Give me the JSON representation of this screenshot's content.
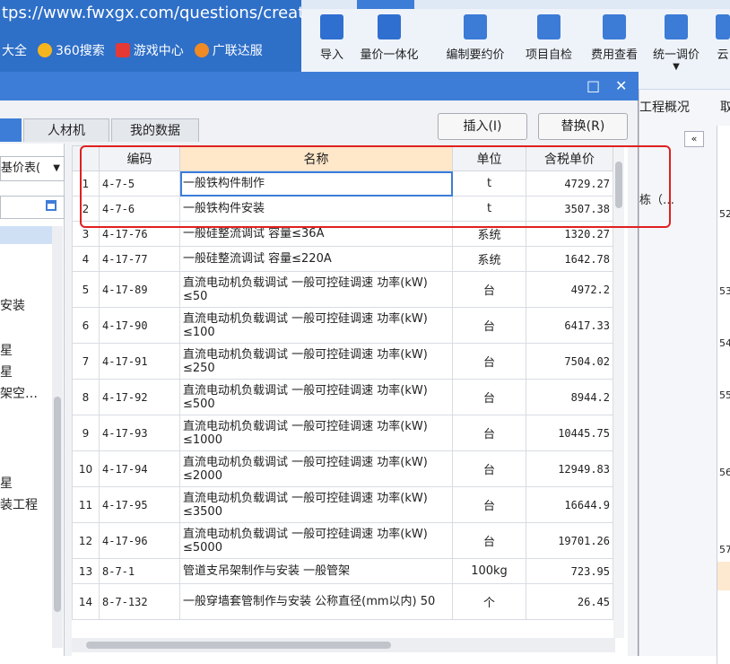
{
  "browser": {
    "url": "tps://www.fwxgx.com/questions/create",
    "bookmarks": [
      {
        "label": "大全",
        "icon": ""
      },
      {
        "label": "360搜索",
        "icon": "360-icon"
      },
      {
        "label": "游戏中心",
        "icon": "game-center-icon"
      },
      {
        "label": "广联达服",
        "icon": "location-icon"
      }
    ]
  },
  "ribbon": {
    "buttons": [
      {
        "label": "导入",
        "icon": "import-icon"
      },
      {
        "label": "量价一体化",
        "icon": "quantity-price-icon"
      },
      {
        "label": "编制要约价",
        "icon": "edit-price-icon"
      },
      {
        "label": "项目自检",
        "icon": "self-check-icon"
      },
      {
        "label": "费用查看",
        "icon": "fee-view-icon"
      },
      {
        "label": "统一调价",
        "icon": "adjust-price-icon"
      },
      {
        "label": "云",
        "icon": "cloud-icon"
      }
    ]
  },
  "right_panel": {
    "tab1": "工程概况",
    "tab2": "取",
    "item": "栋（…",
    "row_labels": [
      "52",
      "53",
      "54",
      "55",
      "56",
      "57"
    ]
  },
  "dialog": {
    "tabs": [
      "人材机",
      "我的数据"
    ],
    "insert_button": "插入(I)",
    "replace_button": "替换(R)",
    "tree_select": "基价表(",
    "tree_items": [
      "安装",
      "星",
      "星",
      "架空…",
      "星",
      "装工程"
    ]
  },
  "grid": {
    "headers": {
      "code": "编码",
      "name": "名称",
      "unit": "单位",
      "price": "含税单价"
    },
    "rows": [
      {
        "num": "1",
        "code": "4-7-5",
        "name": "一般铁构件制作",
        "unit": "t",
        "price": "4729.27"
      },
      {
        "num": "2",
        "code": "4-7-6",
        "name": "一般铁构件安装",
        "unit": "t",
        "price": "3507.38"
      },
      {
        "num": "3",
        "code": "4-17-76",
        "name": "一般硅整流调试 容量≤36A",
        "unit": "系统",
        "price": "1320.27"
      },
      {
        "num": "4",
        "code": "4-17-77",
        "name": "一般硅整流调试 容量≤220A",
        "unit": "系统",
        "price": "1642.78"
      },
      {
        "num": "5",
        "code": "4-17-89",
        "name": "直流电动机负载调试 一般可控硅调速 功率(kW) ≤50",
        "unit": "台",
        "price": "4972.2"
      },
      {
        "num": "6",
        "code": "4-17-90",
        "name": "直流电动机负载调试 一般可控硅调速 功率(kW) ≤100",
        "unit": "台",
        "price": "6417.33"
      },
      {
        "num": "7",
        "code": "4-17-91",
        "name": "直流电动机负载调试 一般可控硅调速 功率(kW) ≤250",
        "unit": "台",
        "price": "7504.02"
      },
      {
        "num": "8",
        "code": "4-17-92",
        "name": "直流电动机负载调试 一般可控硅调速 功率(kW) ≤500",
        "unit": "台",
        "price": "8944.2"
      },
      {
        "num": "9",
        "code": "4-17-93",
        "name": "直流电动机负载调试 一般可控硅调速 功率(kW) ≤1000",
        "unit": "台",
        "price": "10445.75"
      },
      {
        "num": "10",
        "code": "4-17-94",
        "name": "直流电动机负载调试 一般可控硅调速 功率(kW) ≤2000",
        "unit": "台",
        "price": "12949.83"
      },
      {
        "num": "11",
        "code": "4-17-95",
        "name": "直流电动机负载调试 一般可控硅调速 功率(kW) ≤3500",
        "unit": "台",
        "price": "16644.9"
      },
      {
        "num": "12",
        "code": "4-17-96",
        "name": "直流电动机负载调试 一般可控硅调速 功率(kW) ≤5000",
        "unit": "台",
        "price": "19701.26"
      },
      {
        "num": "13",
        "code": "8-7-1",
        "name": "管道支吊架制作与安装 一般管架",
        "unit": "100kg",
        "price": "723.95"
      },
      {
        "num": "14",
        "code": "8-7-132",
        "name": "一般穿墙套管制作与安装 公称直径(mm以内) 50",
        "unit": "个",
        "price": "26.45"
      }
    ]
  }
}
